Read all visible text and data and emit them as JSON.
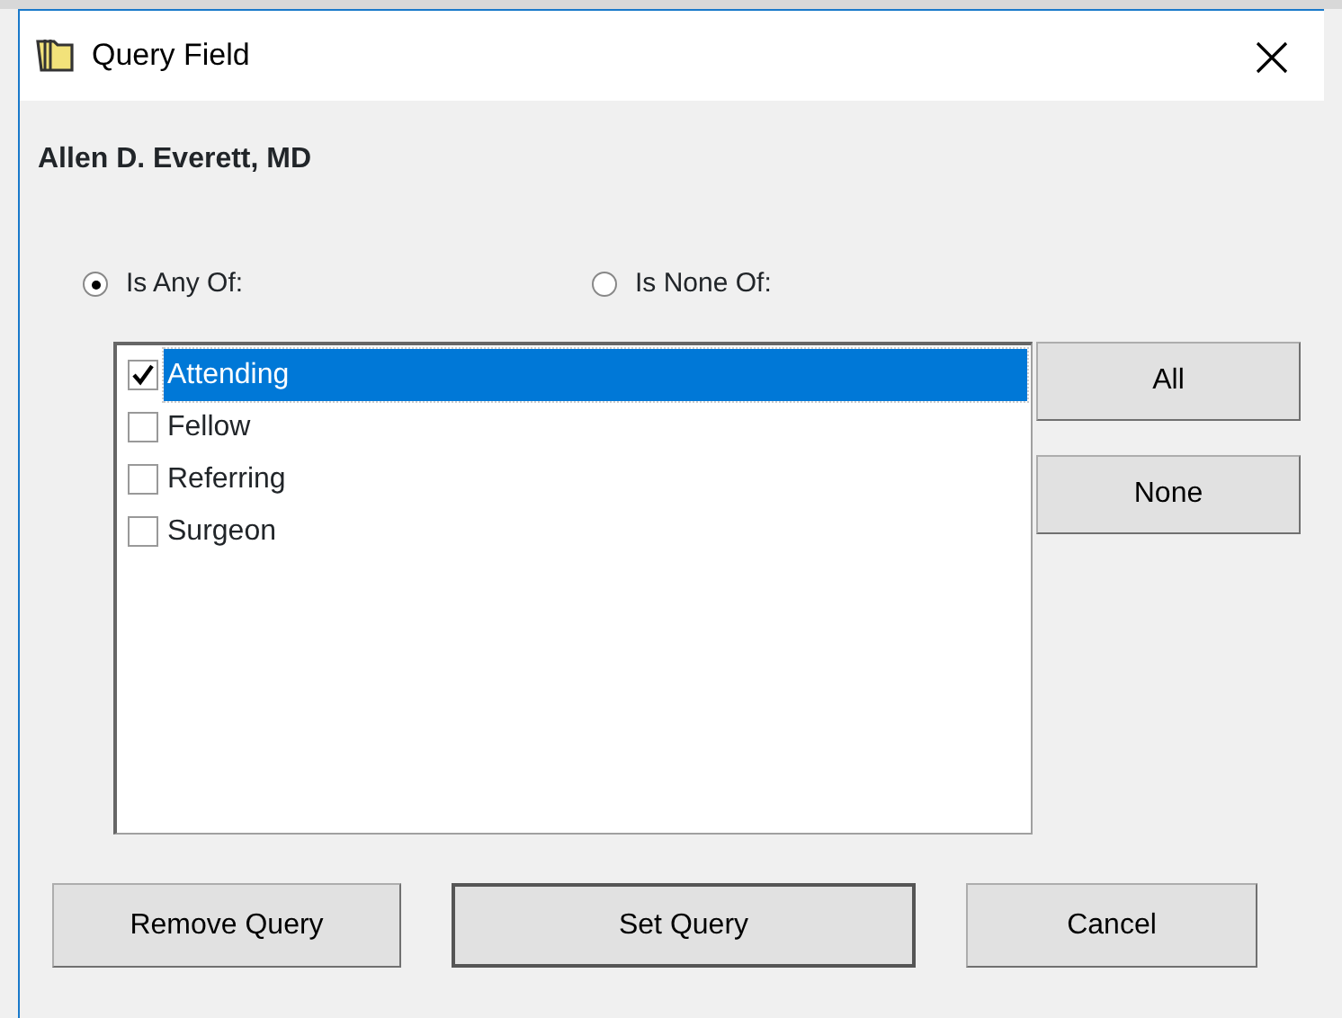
{
  "window": {
    "title": "Query Field"
  },
  "heading": "Allen D. Everett, MD",
  "modes": [
    {
      "label": "Is Any Of:",
      "selected": true
    },
    {
      "label": "Is None Of:",
      "selected": false
    }
  ],
  "items": [
    {
      "label": "Attending",
      "checked": true,
      "selected": true
    },
    {
      "label": "Fellow",
      "checked": false,
      "selected": false
    },
    {
      "label": "Referring",
      "checked": false,
      "selected": false
    },
    {
      "label": "Surgeon",
      "checked": false,
      "selected": false
    }
  ],
  "side_buttons": [
    "All",
    "None"
  ],
  "buttons": [
    {
      "label": "Remove Query",
      "default": false
    },
    {
      "label": "Set Query",
      "default": true
    },
    {
      "label": "Cancel",
      "default": false
    }
  ]
}
